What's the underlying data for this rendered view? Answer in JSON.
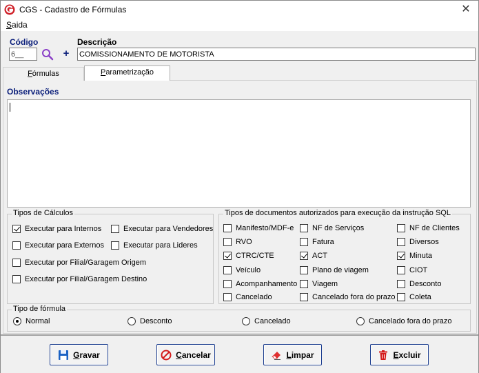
{
  "window": {
    "title": "CGS - Cadastro de Fórmulas",
    "close_glyph": "✕"
  },
  "menu": {
    "items": [
      {
        "label_u": "S",
        "label_rest": "aida"
      }
    ]
  },
  "header": {
    "codigo_label": "Código",
    "codigo_value": "6__",
    "descricao_label": "Descrição",
    "descricao_value": "COMISSIONAMENTO DE MOTORISTA",
    "add_glyph": "+"
  },
  "tabs": [
    {
      "pre": "",
      "u": "F",
      "post": "órmulas",
      "active": false
    },
    {
      "pre": "",
      "u": "P",
      "post": "arametrização",
      "active": true
    }
  ],
  "observacoes": {
    "label": "Observações",
    "value": ""
  },
  "tipos_calculos": {
    "title": "Tipos de Cálculos",
    "items": [
      {
        "label": "Executar para Internos",
        "checked": true
      },
      {
        "label": "Executar para Vendedores",
        "checked": false
      },
      {
        "label": "Executar para Externos",
        "checked": false
      },
      {
        "label": "Executar para Lideres",
        "checked": false
      },
      {
        "label": "Executar por Filial/Garagem Origem",
        "checked": false
      },
      {
        "label": "Executar por Filial/Garagem Destino",
        "checked": false
      }
    ]
  },
  "tipos_documentos": {
    "title": "Tipos de documentos autorizados para execução da instrução SQL",
    "items": [
      {
        "label": "Manifesto/MDF-e",
        "checked": false
      },
      {
        "label": "NF de Serviços",
        "checked": false
      },
      {
        "label": "NF de Clientes",
        "checked": false
      },
      {
        "label": "RVO",
        "checked": false
      },
      {
        "label": "Fatura",
        "checked": false
      },
      {
        "label": "Diversos",
        "checked": false
      },
      {
        "label": "CTRC/CTE",
        "checked": true
      },
      {
        "label": "ACT",
        "checked": true
      },
      {
        "label": "Minuta",
        "checked": true
      },
      {
        "label": "Veículo",
        "checked": false
      },
      {
        "label": "Plano de viagem",
        "checked": false
      },
      {
        "label": "CIOT",
        "checked": false
      },
      {
        "label": "Acompanhamento",
        "checked": false
      },
      {
        "label": "Viagem",
        "checked": false
      },
      {
        "label": "Desconto",
        "checked": false
      },
      {
        "label": "Cancelado",
        "checked": false
      },
      {
        "label": "Cancelado fora do prazo",
        "checked": false
      },
      {
        "label": "Coleta",
        "checked": false
      }
    ]
  },
  "tipo_formula": {
    "title": "Tipo de fórmula",
    "options": [
      {
        "label": "Normal",
        "selected": true
      },
      {
        "label": "Desconto",
        "selected": false
      },
      {
        "label": "Cancelado",
        "selected": false
      },
      {
        "label": "Cancelado fora do prazo",
        "selected": false
      }
    ]
  },
  "buttons": {
    "gravar": {
      "u": "G",
      "rest": "ravar"
    },
    "cancelar": {
      "u": "C",
      "rest": "ancelar"
    },
    "limpar": {
      "u": "L",
      "rest": "impar"
    },
    "excluir": {
      "u": "E",
      "rest": "xcluir"
    }
  },
  "colors": {
    "accent_blue": "#0a1e7a",
    "logo_red": "#d0222a",
    "search_purple": "#8a3fc7",
    "delete_red": "#d41c1c"
  },
  "icons": [
    "app-logo-icon",
    "close-icon",
    "search-icon",
    "add-icon",
    "save-icon",
    "cancel-icon",
    "eraser-icon",
    "trash-icon"
  ]
}
